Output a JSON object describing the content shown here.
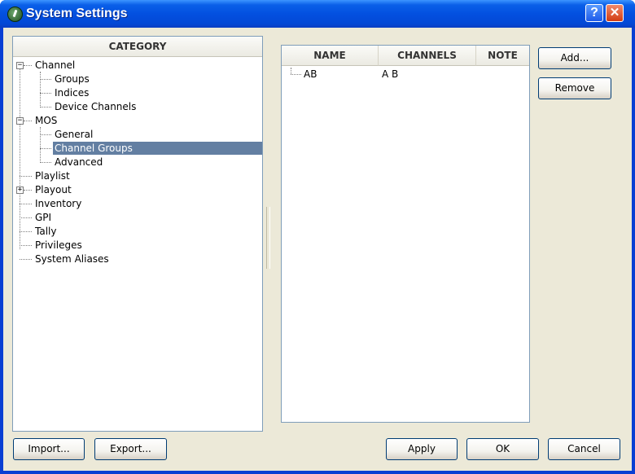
{
  "window": {
    "title": "System Settings",
    "help_glyph": "?",
    "close_glyph": "✕"
  },
  "category": {
    "header": "CATEGORY",
    "items": [
      {
        "label": "Channel",
        "level": 0,
        "expander": "−"
      },
      {
        "label": "Groups",
        "level": 1
      },
      {
        "label": "Indices",
        "level": 1
      },
      {
        "label": "Device Channels",
        "level": 1
      },
      {
        "label": "MOS",
        "level": 0,
        "expander": "−"
      },
      {
        "label": "General",
        "level": 1
      },
      {
        "label": "Channel Groups",
        "level": 1,
        "selected": true
      },
      {
        "label": "Advanced",
        "level": 1
      },
      {
        "label": "Playlist",
        "level": 0
      },
      {
        "label": "Playout",
        "level": 0,
        "expander": "+"
      },
      {
        "label": "Inventory",
        "level": 0
      },
      {
        "label": "GPI",
        "level": 0
      },
      {
        "label": "Tally",
        "level": 0
      },
      {
        "label": "Privileges",
        "level": 0
      },
      {
        "label": "System Aliases",
        "level": 0
      }
    ]
  },
  "groups_list": {
    "columns": [
      "NAME",
      "CHANNELS",
      "NOTE"
    ],
    "rows": [
      {
        "name": "AB",
        "channels": "A B",
        "note": ""
      }
    ]
  },
  "buttons": {
    "add": "Add...",
    "remove": "Remove",
    "import": "Import...",
    "export": "Export...",
    "apply": "Apply",
    "ok": "OK",
    "cancel": "Cancel"
  },
  "colors": {
    "titlebar": "#0350e0",
    "selection": "#637fa2",
    "dialog_bg": "#ece9d8"
  }
}
